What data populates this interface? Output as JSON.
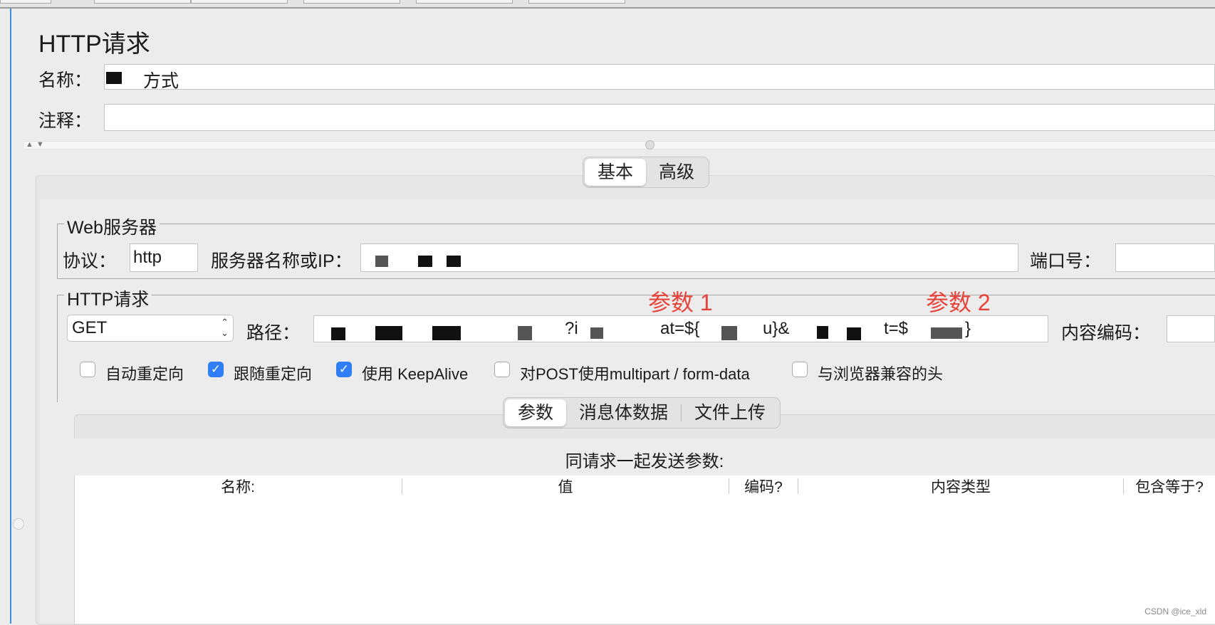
{
  "page_title": "HTTP请求",
  "name_field": {
    "label": "名称：",
    "value": "方式"
  },
  "comment_field": {
    "label": "注释：",
    "value": ""
  },
  "top_tabs": [
    {
      "label": "基本",
      "active": true
    },
    {
      "label": "高级",
      "active": false
    }
  ],
  "web_server": {
    "group_title": "Web服务器",
    "protocol_label": "协议：",
    "protocol_value": "http",
    "server_label": "服务器名称或IP：",
    "port_label": "端口号："
  },
  "http_request": {
    "group_title": "HTTP请求",
    "method_value": "GET",
    "path_label": "路径：",
    "path_fragments": [
      "?i",
      "at=${",
      "u}&",
      "t=$",
      "}"
    ],
    "encoding_label": "内容编码："
  },
  "annotations": [
    {
      "text": "参数 1",
      "color": "#e8433a"
    },
    {
      "text": "参数 2",
      "color": "#e8433a"
    }
  ],
  "checkboxes": [
    {
      "label": "自动重定向",
      "checked": false
    },
    {
      "label": "跟随重定向",
      "checked": true
    },
    {
      "label": "使用 KeepAlive",
      "checked": true
    },
    {
      "label": "对POST使用multipart / form-data",
      "checked": false
    },
    {
      "label": "与浏览器兼容的头",
      "checked": false
    }
  ],
  "sub_tabs": [
    {
      "label": "参数",
      "active": true
    },
    {
      "label": "消息体数据",
      "active": false
    },
    {
      "label": "文件上传",
      "active": false
    }
  ],
  "params_table": {
    "caption": "同请求一起发送参数:",
    "columns": [
      "名称:",
      "值",
      "编码?",
      "内容类型",
      "包含等于?"
    ],
    "rows": []
  },
  "watermark": "CSDN @ice_xld",
  "colors": {
    "accent_blue": "#2f7ef6",
    "annotation_red": "#e8433a",
    "left_selection_line": "#3b8fd9"
  }
}
